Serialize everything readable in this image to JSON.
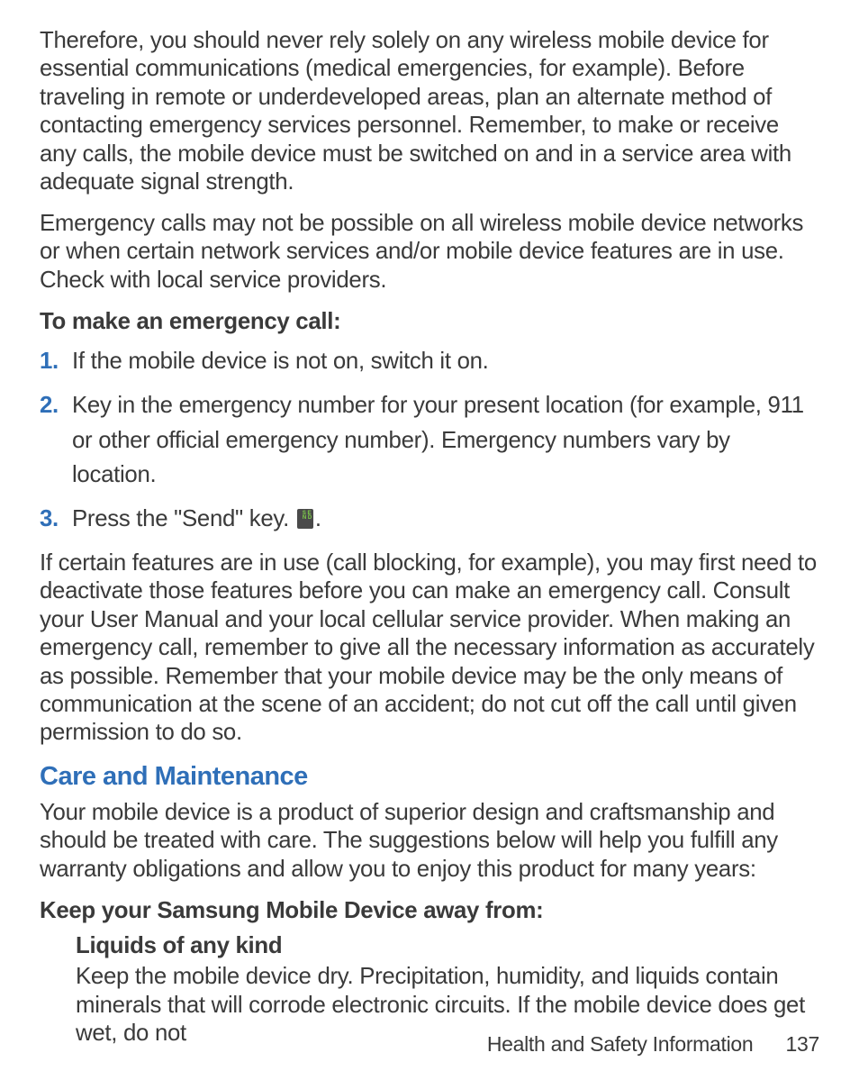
{
  "para1": "Therefore, you should never rely solely on any wireless mobile device for essential communications (medical emergencies, for example). Before traveling in remote or underdeveloped areas, plan an alternate method of contacting emergency services personnel. Remember, to make or receive any calls, the mobile device must be switched on and in a service area with adequate signal strength.",
  "para2": "Emergency calls may not be possible on all wireless mobile device networks or when certain network services and/or mobile device features are in use. Check with local service providers.",
  "emergency_heading": "To make an emergency call:",
  "steps": [
    {
      "num": "1.",
      "text": "If the mobile device is not on, switch it on."
    },
    {
      "num": "2.",
      "text": "Key in the emergency number for your present location (for example, 911 or other official emergency number). Emergency numbers vary by location."
    },
    {
      "num": "3.",
      "text_before": "Press the \"Send\" key. ",
      "text_after": "."
    }
  ],
  "para3": "If certain features are in use (call blocking, for example), you may first need to deactivate those features before you can make an emergency call. Consult your User Manual and your local cellular service provider. When making an emergency call, remember to give all the necessary information as accurately as possible. Remember that your mobile device may be the only means of communication at the scene of an accident; do not cut off the call until given permission to do so.",
  "section_heading": "Care and Maintenance",
  "para4": "Your mobile device is a product of superior design and craftsmanship and should be treated with care. The suggestions below will help you fulfill any warranty obligations and allow you to enjoy this product for many years:",
  "keep_away_heading": "Keep your Samsung Mobile Device away from:",
  "liquids_heading": "Liquids of any kind",
  "liquids_body": "Keep the mobile device dry. Precipitation, humidity, and liquids contain minerals that will corrode electronic circuits. If the mobile device does get wet, do not",
  "footer_label": "Health and Safety Information",
  "footer_page": "137",
  "send_icon_text": "S\nE\nN\nD"
}
